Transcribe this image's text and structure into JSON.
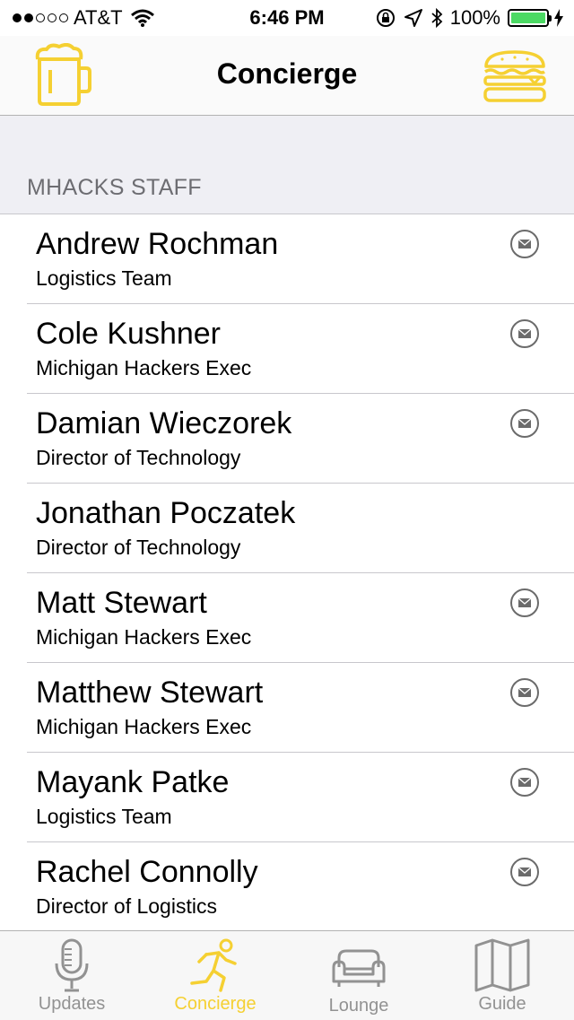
{
  "status_bar": {
    "carrier": "AT&T",
    "time": "6:46 PM",
    "battery": "100%"
  },
  "nav": {
    "title": "Concierge",
    "left_icon": "beer-mug-icon",
    "right_icon": "burger-icon"
  },
  "section": {
    "title": "MHACKS STAFF"
  },
  "staff": [
    {
      "name": "Andrew Rochman",
      "role": "Logistics Team",
      "has_mail": true
    },
    {
      "name": "Cole Kushner",
      "role": "Michigan Hackers Exec",
      "has_mail": true
    },
    {
      "name": "Damian Wieczorek",
      "role": "Director of Technology",
      "has_mail": true
    },
    {
      "name": "Jonathan Poczatek",
      "role": "Director of Technology",
      "has_mail": false
    },
    {
      "name": "Matt Stewart",
      "role": "Michigan Hackers Exec",
      "has_mail": true
    },
    {
      "name": "Matthew Stewart",
      "role": "Michigan Hackers Exec",
      "has_mail": true
    },
    {
      "name": "Mayank Patke",
      "role": "Logistics Team",
      "has_mail": true
    },
    {
      "name": "Rachel Connolly",
      "role": "Director of Logistics",
      "has_mail": true
    }
  ],
  "tabs": [
    {
      "label": "Updates",
      "icon": "microphone-icon",
      "active": false
    },
    {
      "label": "Concierge",
      "icon": "runner-icon",
      "active": true
    },
    {
      "label": "Lounge",
      "icon": "couch-icon",
      "active": false
    },
    {
      "label": "Guide",
      "icon": "map-icon",
      "active": false
    }
  ],
  "colors": {
    "accent": "#f5d032",
    "inactive": "#929292",
    "section_bg": "#efeff4",
    "battery": "#4cd964"
  }
}
